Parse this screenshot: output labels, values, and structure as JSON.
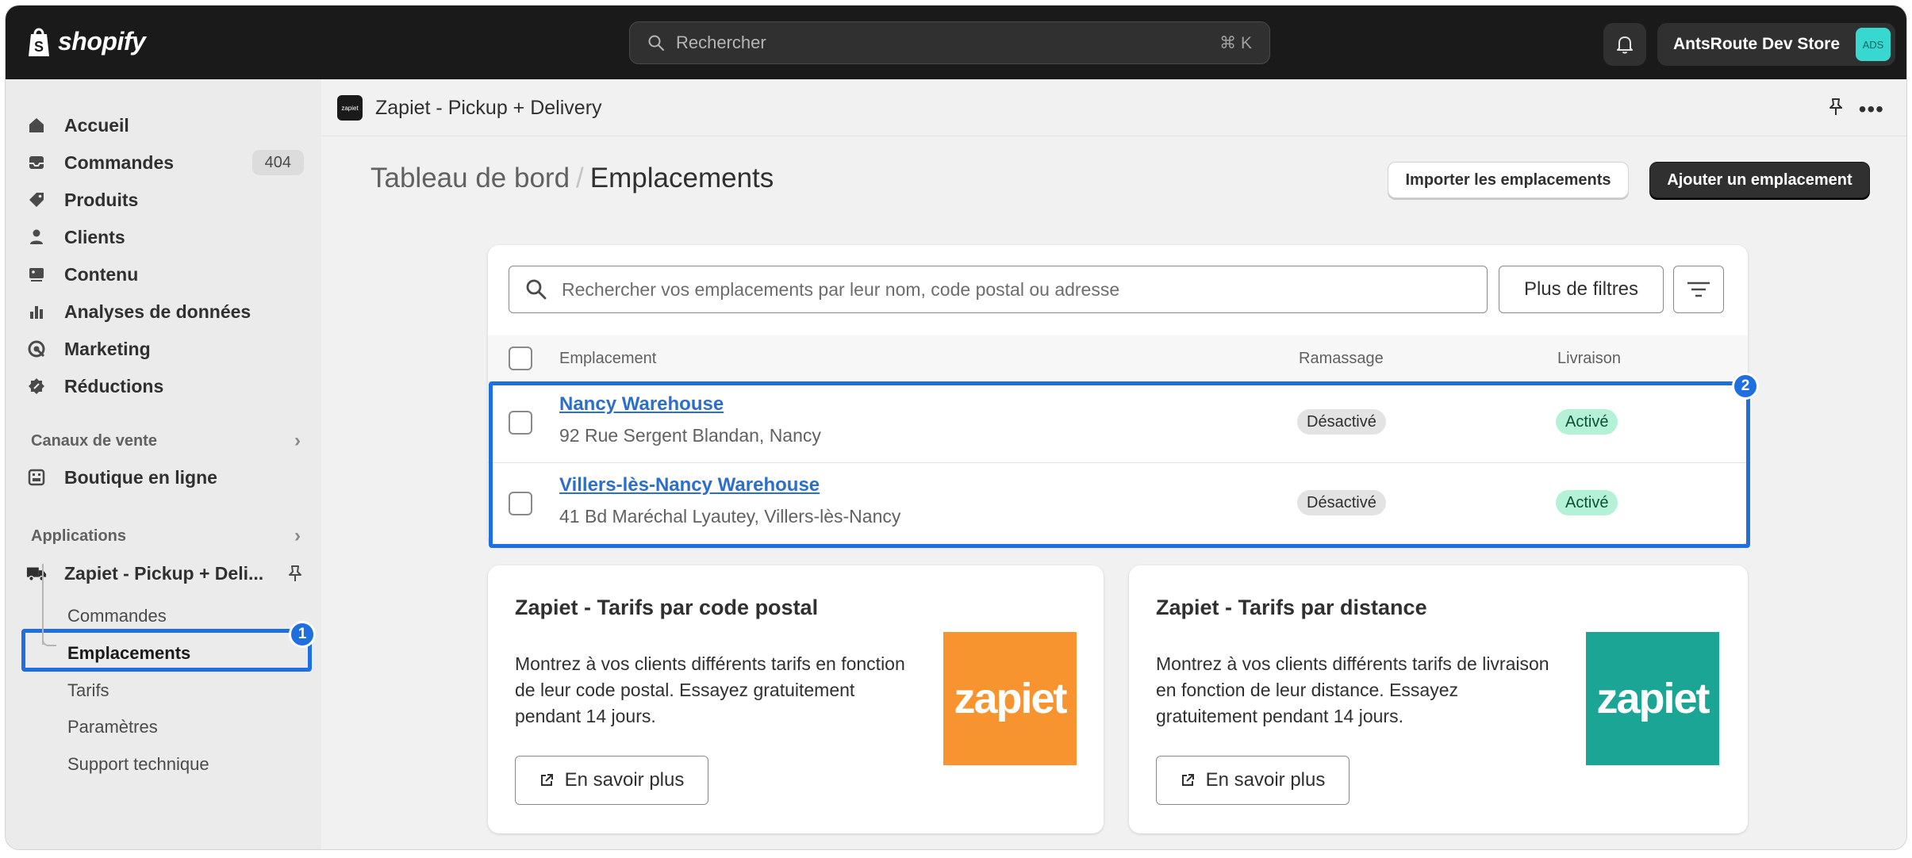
{
  "topbar": {
    "brand": "shopify",
    "search_placeholder": "Rechercher",
    "search_shortcut": "⌘ K",
    "store_name": "AntsRoute Dev Store",
    "store_initials": "ADS"
  },
  "sidebar": {
    "items": [
      {
        "label": "Accueil",
        "icon": "home-icon"
      },
      {
        "label": "Commandes",
        "icon": "inbox-icon",
        "badge": "404"
      },
      {
        "label": "Produits",
        "icon": "tag-icon"
      },
      {
        "label": "Clients",
        "icon": "person-icon"
      },
      {
        "label": "Contenu",
        "icon": "content-icon"
      },
      {
        "label": "Analyses de données",
        "icon": "bar-chart-icon"
      },
      {
        "label": "Marketing",
        "icon": "target-icon"
      },
      {
        "label": "Réductions",
        "icon": "discount-icon"
      }
    ],
    "sales_channels_label": "Canaux de vente",
    "online_store_label": "Boutique en ligne",
    "apps_label": "Applications",
    "app_label": "Zapiet - Pickup + Deli...",
    "app_subitems": [
      "Commandes",
      "Emplacements",
      "Tarifs",
      "Paramètres",
      "Support technique"
    ]
  },
  "appbar": {
    "app_icon_text": "zapiet",
    "app_name": "Zapiet - Pickup + Delivery"
  },
  "page": {
    "breadcrumb_parent": "Tableau de bord",
    "breadcrumb_sep": "/",
    "title": "Emplacements",
    "import_button": "Importer les emplacements",
    "add_button": "Ajouter un emplacement"
  },
  "locations": {
    "search_placeholder": "Rechercher vos emplacements par leur nom, code postal ou adresse",
    "more_filters": "Plus de filtres",
    "columns": {
      "location": "Emplacement",
      "pickup": "Ramassage",
      "delivery": "Livraison"
    },
    "rows": [
      {
        "name": "Nancy Warehouse",
        "address": "92 Rue Sergent Blandan, Nancy",
        "pickup": "Désactivé",
        "delivery": "Activé"
      },
      {
        "name": "Villers-lès-Nancy Warehouse",
        "address": "41 Bd Maréchal Lyautey, Villers-lès-Nancy",
        "pickup": "Désactivé",
        "delivery": "Activé"
      }
    ]
  },
  "promos": [
    {
      "title": "Zapiet - Tarifs par code postal",
      "text": "Montrez à vos clients différents tarifs en fonction de leur code postal. Essayez gratuitement pendant 14 jours.",
      "button": "En savoir plus",
      "logo_text": "zapiet",
      "logo_color": "#f7942f"
    },
    {
      "title": "Zapiet - Tarifs par distance",
      "text": "Montrez à vos clients différents tarifs de livraison en fonction de leur distance. Essayez gratuitement pendant 14 jours.",
      "button": "En savoir plus",
      "logo_text": "zapiet",
      "logo_color": "#1aa594"
    }
  ],
  "annotations": {
    "marker_1": "1",
    "marker_2": "2"
  },
  "colors": {
    "highlight": "#1f6fe0",
    "active_pill": "#b4f1d6",
    "link": "#2c6ecb"
  }
}
